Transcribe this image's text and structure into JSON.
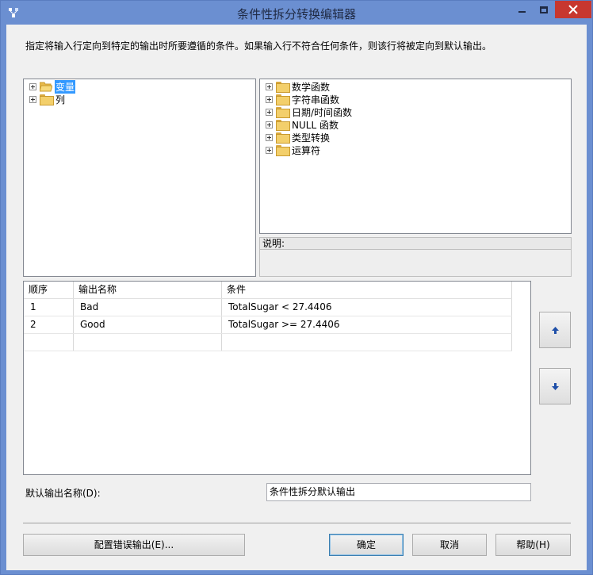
{
  "window": {
    "title": "条件性拆分转换编辑器"
  },
  "description": "指定将输入行定向到特定的输出时所要遵循的条件。如果输入行不符合任何条件，则该行将被定向到默认输出。",
  "left_tree": {
    "items": [
      {
        "label": "变量",
        "selected": true,
        "open": true
      },
      {
        "label": "列",
        "selected": false
      }
    ]
  },
  "right_tree": {
    "items": [
      {
        "label": "数学函数"
      },
      {
        "label": "字符串函数"
      },
      {
        "label": "日期/时间函数"
      },
      {
        "label": "NULL 函数"
      },
      {
        "label": "类型转换"
      },
      {
        "label": "运算符"
      }
    ]
  },
  "description_box": {
    "label": "说明:"
  },
  "grid": {
    "columns": [
      "顺序",
      "输出名称",
      "条件"
    ],
    "rows": [
      {
        "order": "1",
        "name": "Bad",
        "condition": "TotalSugar < 27.4406"
      },
      {
        "order": "2",
        "name": "Good",
        "condition": "TotalSugar >= 27.4406"
      }
    ]
  },
  "default_output": {
    "label": "默认输出名称(D):",
    "value": "条件性拆分默认输出"
  },
  "buttons": {
    "configure_error": "配置错误输出(E)...",
    "ok": "确定",
    "cancel": "取消",
    "help": "帮助(H)"
  },
  "colors": {
    "titlebar": "#6b8fd1",
    "close_button": "#c7372f",
    "selection": "#3399ff"
  }
}
